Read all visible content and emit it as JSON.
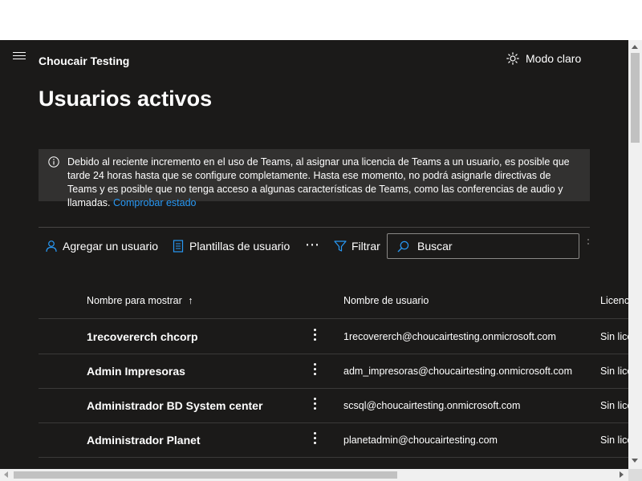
{
  "header": {
    "tenant_name": "Choucair Testing",
    "mode_label": "Modo claro"
  },
  "page": {
    "title": "Usuarios activos"
  },
  "banner": {
    "text": "Debido al reciente incremento en el uso de Teams, al asignar una licencia de Teams a un usuario, es posible que tarde 24 horas hasta que se configure completamente. Hasta ese momento, no podrá asignarle directivas de Teams y es posible que no tenga acceso a algunas características de Teams, como las conferencias de audio y llamadas.",
    "link": "Comprobar estado"
  },
  "toolbar": {
    "add_user": "Agregar un usuario",
    "templates": "Plantillas de usuario",
    "more": "⋯",
    "filter": "Filtrar",
    "search_placeholder": "Buscar"
  },
  "table": {
    "columns": {
      "display_name": "Nombre para mostrar",
      "sort_indicator": "↑",
      "username": "Nombre de usuario",
      "licenses": "Licencias"
    },
    "rows": [
      {
        "name": "1recovererch chcorp",
        "username": "1recovererch@choucairtesting.onmicrosoft.com",
        "license": "Sin licencia"
      },
      {
        "name": "Admin Impresoras",
        "username": "adm_impresoras@choucairtesting.onmicrosoft.com",
        "license": "Sin licencia"
      },
      {
        "name": "Administrador BD System center",
        "username": "scsql@choucairtesting.onmicrosoft.com",
        "license": "Sin licencia"
      },
      {
        "name": "Administrador Planet",
        "username": "planetadmin@choucairtesting.com",
        "license": "Sin licencia"
      }
    ]
  },
  "colors": {
    "app_background": "#1b1a19",
    "banner_background": "#323130",
    "link": "#2899f5"
  },
  "icons": {
    "menu": "hamburger-icon",
    "mode": "sun-icon",
    "info": "info-icon",
    "add_user": "person-icon",
    "templates": "document-icon",
    "filter": "funnel-icon",
    "search": "search-icon",
    "row_actions": "vertical-ellipsis-icon"
  }
}
